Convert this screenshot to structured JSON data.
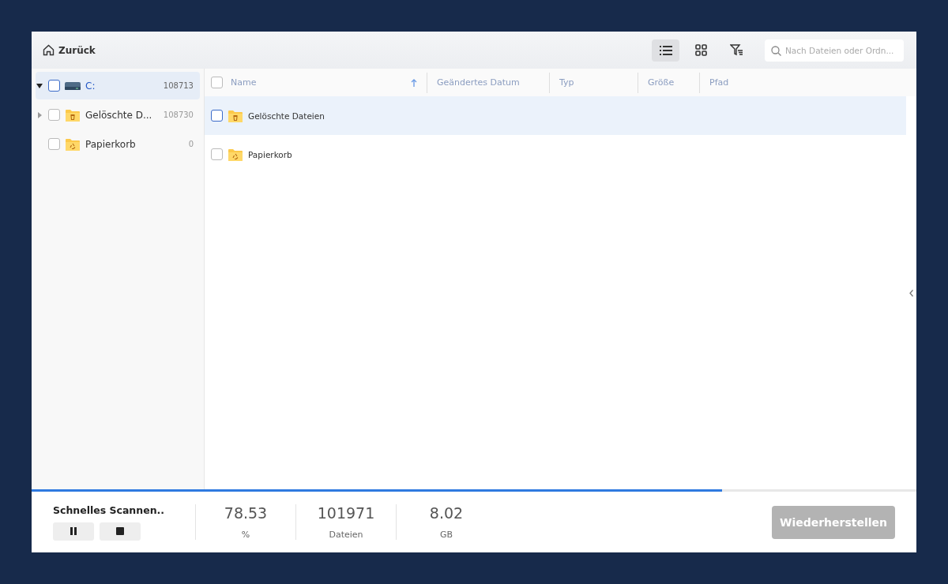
{
  "toolbar": {
    "back": "Zurück",
    "views": [
      {
        "kind": "list",
        "selected": true
      },
      {
        "kind": "grid",
        "selected": false
      }
    ],
    "search": {
      "placeholder": "Nach Dateien oder Ordn..."
    }
  },
  "tree": [
    {
      "label": "C:",
      "count": "108713",
      "kind": "drive",
      "selected": true,
      "checked": false,
      "expanded": true,
      "children": [
        {
          "label": "Gelöschte D...",
          "count": "108730",
          "kind": "trash",
          "selected": false,
          "checked": false,
          "expanded": false
        },
        {
          "label": "Papierkorb",
          "count": "0",
          "kind": "recycle",
          "selected": false,
          "checked": false
        }
      ]
    }
  ],
  "table": {
    "columns": [
      {
        "label": "Name",
        "sorted": true
      },
      {
        "label": "Geändertes Datum",
        "sorted": false
      },
      {
        "label": "Typ",
        "sorted": false
      },
      {
        "label": "Größe",
        "sorted": false
      },
      {
        "label": "Pfad",
        "sorted": false
      }
    ],
    "rows": [
      {
        "name": "Gelöschte Dateien",
        "kind": "trash",
        "selected": true,
        "checked": false
      },
      {
        "name": "Papierkorb",
        "kind": "recycle",
        "selected": false,
        "checked": false
      }
    ]
  },
  "scan": {
    "level": 0.78,
    "title": "Schnelles Scannen..",
    "stats": [
      {
        "value": "78.53",
        "unit": "%"
      },
      {
        "value": "101971",
        "unit": "Dateien"
      },
      {
        "value": "8.02",
        "unit": "GB"
      }
    ],
    "restore": {
      "label": "Wiederherstellen",
      "disabled": true
    }
  }
}
